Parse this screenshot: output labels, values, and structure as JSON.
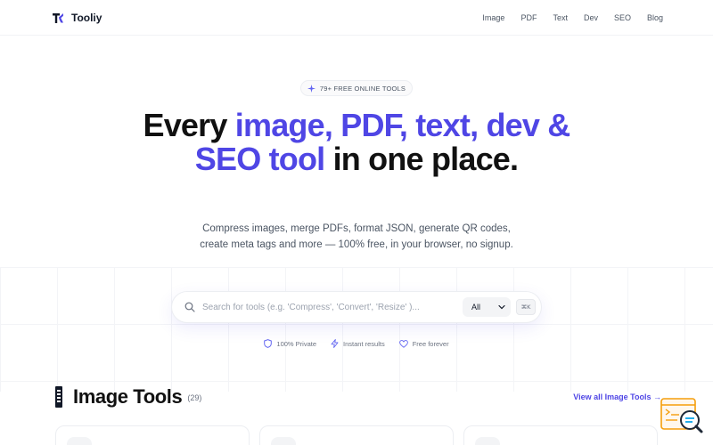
{
  "nav": {
    "brand": "Tooliy",
    "links": [
      "Image",
      "PDF",
      "Text",
      "Dev",
      "SEO",
      "Blog"
    ]
  },
  "hero": {
    "badge": "79+ FREE ONLINE TOOLS",
    "headline_plain_1": "Every ",
    "headline_accent": "image, PDF, text, dev & SEO tool",
    "headline_plain_2": " in one place.",
    "subtitle": "Compress images, merge PDFs, format JSON, generate QR codes, create meta tags and more — 100% free, in your browser, no signup."
  },
  "search": {
    "placeholder": "Search for tools (e.g. 'Compress', 'Convert', 'Resize' )...",
    "value": "",
    "filter_selected": "All",
    "shortcut": "⌘K"
  },
  "features": [
    "100% Private",
    "Instant results",
    "Free forever"
  ],
  "section": {
    "title": "Image Tools",
    "count": "(29)",
    "view_all": "View all Image Tools →"
  },
  "colors": {
    "accent": "#4f46e5",
    "text": "#111111",
    "muted": "#4b5563"
  },
  "icons": {
    "brand": "tooliy-logo-icon",
    "badge": "sparkle-icon",
    "search": "search-icon",
    "select": "chevron-down-icon",
    "features": [
      "shield-icon",
      "lightning-icon",
      "heart-icon"
    ],
    "section": "image-tools-icon",
    "floating": "search-results-icon"
  }
}
